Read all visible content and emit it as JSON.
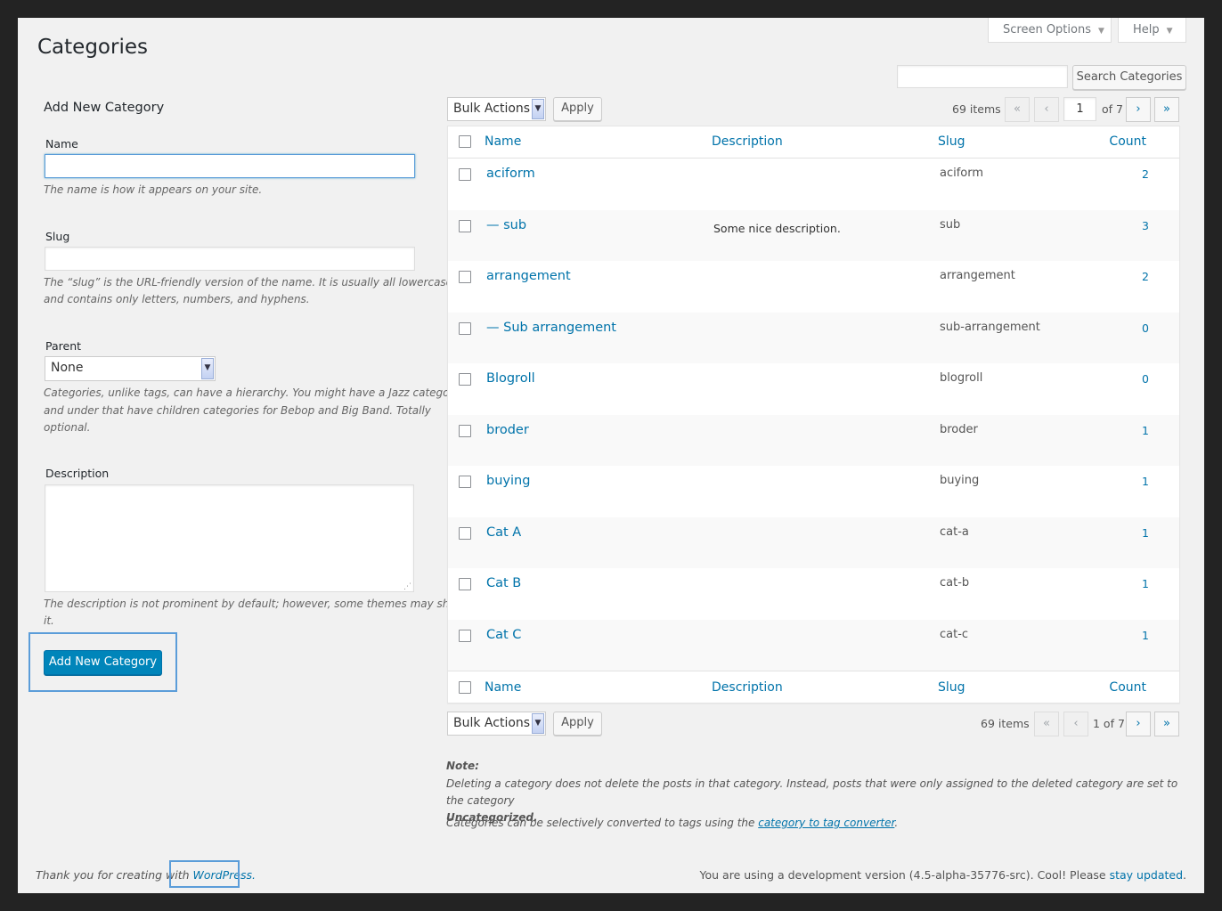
{
  "header": {
    "title": "Categories",
    "screen_options": "Screen Options",
    "help": "Help"
  },
  "search": {
    "value": "",
    "button": "Search Categories"
  },
  "form": {
    "heading": "Add New Category",
    "name_label": "Name",
    "name_value": "",
    "name_hint": "The name is how it appears on your site.",
    "slug_label": "Slug",
    "slug_value": "",
    "slug_hint_1": "The “slug” is the URL-friendly version of the name. It is usually all lowercase",
    "slug_hint_2": "and contains only letters, numbers, and hyphens.",
    "parent_label": "Parent",
    "parent_value": "None",
    "parent_hint_1": "Categories, unlike tags, can have a hierarchy. You might have a Jazz category,",
    "parent_hint_2": "and under that have children categories for Bebop and Big Band. Totally",
    "parent_hint_3": "optional.",
    "description_label": "Description",
    "description_value": "",
    "description_hint_1": "The description is not prominent by default; however, some themes may show",
    "description_hint_2": "it.",
    "submit": "Add New Category"
  },
  "tablenav_top": {
    "bulk": "Bulk Actions",
    "apply": "Apply",
    "items": "69 items",
    "first": "«",
    "prev": "‹",
    "page_value": "1",
    "of_pages": "of 7",
    "next": "›",
    "last": "»"
  },
  "tablenav_bottom": {
    "bulk": "Bulk Actions",
    "apply": "Apply",
    "items": "69 items",
    "first": "«",
    "prev": "‹",
    "page_text": "1 of 7",
    "next": "›",
    "last": "»"
  },
  "columns": {
    "name": "Name",
    "description": "Description",
    "slug": "Slug",
    "count": "Count"
  },
  "rows": [
    {
      "name": "aciform",
      "description": "",
      "slug": "aciform",
      "count": "2"
    },
    {
      "name": "— sub",
      "description": "Some nice description.",
      "slug": "sub",
      "count": "3"
    },
    {
      "name": "arrangement",
      "description": "",
      "slug": "arrangement",
      "count": "2"
    },
    {
      "name": "— Sub arrangement",
      "description": "",
      "slug": "sub-arrangement",
      "count": "0"
    },
    {
      "name": "Blogroll",
      "description": "",
      "slug": "blogroll",
      "count": "0"
    },
    {
      "name": "broder",
      "description": "",
      "slug": "broder",
      "count": "1"
    },
    {
      "name": "buying",
      "description": "",
      "slug": "buying",
      "count": "1"
    },
    {
      "name": "Cat A",
      "description": "",
      "slug": "cat-a",
      "count": "1"
    },
    {
      "name": "Cat B",
      "description": "",
      "slug": "cat-b",
      "count": "1"
    },
    {
      "name": "Cat C",
      "description": "",
      "slug": "cat-c",
      "count": "1"
    }
  ],
  "notes": {
    "title": "Note:",
    "line1": "Deleting a category does not delete the posts in that category. Instead, posts that were only assigned to the deleted category are set to the category",
    "line1_bold": "Uncategorized.",
    "line2_pre": "Categories can be selectively converted to tags using the ",
    "line2_link": "category to tag converter",
    "line2_post": "."
  },
  "footer": {
    "left_text": "Thank you for creating with ",
    "left_link": "WordPress.",
    "right_text": "You are using a development version (4.5-alpha-35776-src). Cool! Please ",
    "right_link": "stay updated",
    "right_end": "."
  },
  "colors": {
    "link": "#0073aa",
    "primary": "#0085ba",
    "focus": "#5b9dd9"
  }
}
